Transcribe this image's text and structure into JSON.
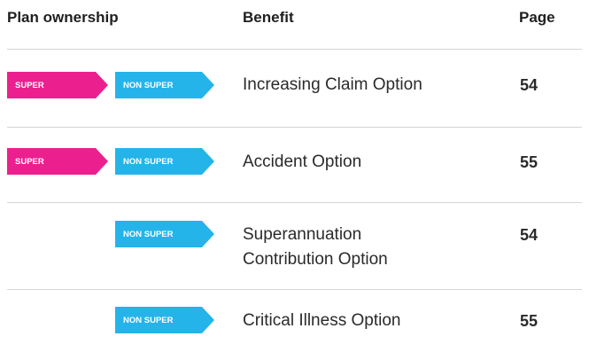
{
  "headers": {
    "ownership": "Plan ownership",
    "benefit": "Benefit",
    "page": "Page"
  },
  "tags": {
    "super": "SUPER",
    "non_super": "NON SUPER"
  },
  "colors": {
    "super": "#ec1f8e",
    "non_super": "#24b4ea",
    "rule": "#d6d6d6"
  },
  "rows": [
    {
      "super": true,
      "non_super": true,
      "benefit": "Increasing Claim Option",
      "page": "54"
    },
    {
      "super": true,
      "non_super": true,
      "benefit": "Accident Option",
      "page": "55"
    },
    {
      "super": false,
      "non_super": true,
      "benefit_line1": "Superannuation",
      "benefit_line2": "Contribution Option",
      "page": "54"
    },
    {
      "super": false,
      "non_super": true,
      "benefit": "Critical Illness Option",
      "page": "55"
    }
  ]
}
